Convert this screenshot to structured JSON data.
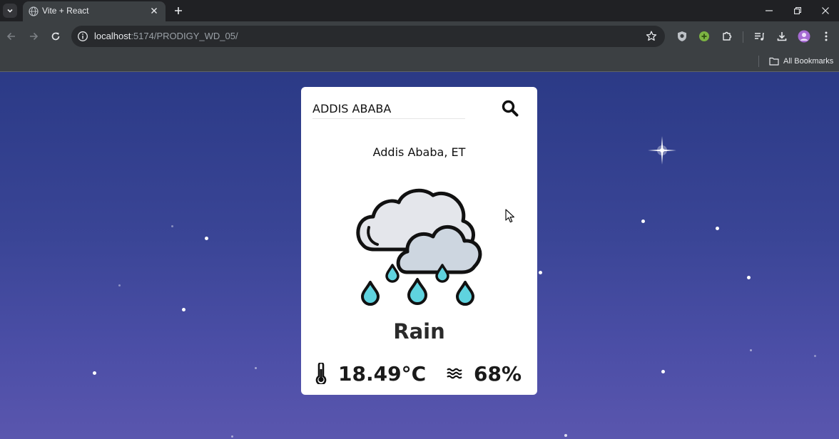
{
  "browser": {
    "tab_title": "Vite + React",
    "url_host": "localhost",
    "url_path": ":5174/PRODIGY_WD_05/",
    "bookmarks_label": "All Bookmarks"
  },
  "colors": {
    "page_bg_top": "#2b3a86",
    "page_bg_bottom": "#5a56ae",
    "card_bg": "#ffffff",
    "raindrop": "#5fd3df",
    "cloud_back": "#e4e6eb",
    "cloud_front": "#cdd6e0"
  },
  "search": {
    "value": "ADDIS ABABA",
    "button_icon": "search-icon"
  },
  "weather": {
    "location": "Addis Ababa, ET",
    "icon": "cloud-rain-icon",
    "condition": "Rain",
    "temperature": "18.49°C",
    "temperature_icon": "thermometer-icon",
    "humidity": "68%",
    "humidity_icon": "humidity-waves-icon"
  }
}
